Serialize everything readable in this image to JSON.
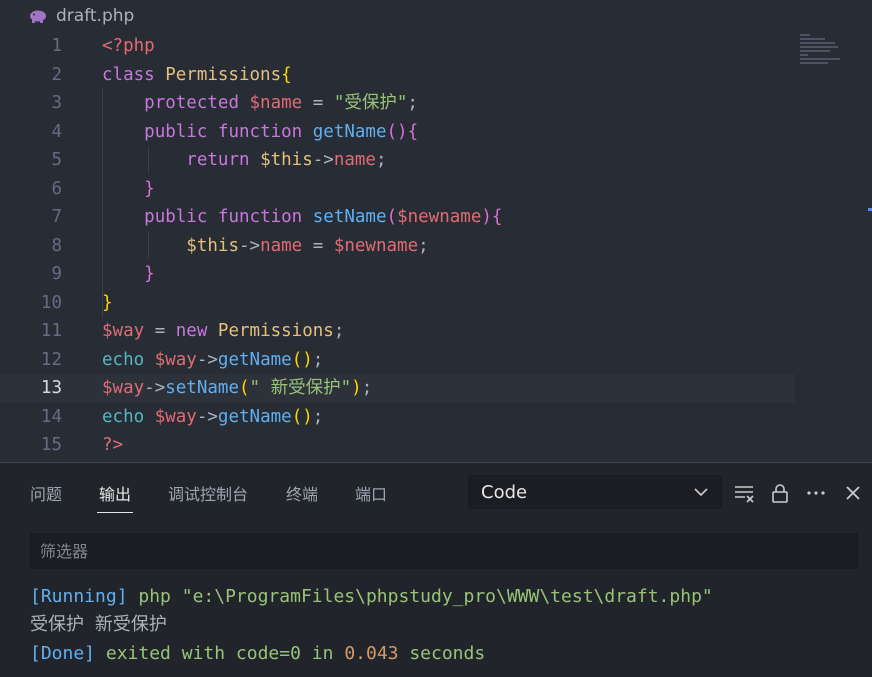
{
  "tab": {
    "filename": "draft.php"
  },
  "editor": {
    "active_line": 13,
    "lines": [
      {
        "n": "1",
        "tokens": [
          [
            "c-tag",
            "<?php"
          ]
        ]
      },
      {
        "n": "2",
        "tokens": [
          [
            "c-kw",
            "class "
          ],
          [
            "c-cls",
            "Permissions"
          ],
          [
            "c-br3",
            "{"
          ]
        ]
      },
      {
        "n": "3",
        "tokens": [
          [
            "c-plain",
            "    "
          ],
          [
            "c-kw",
            "protected "
          ],
          [
            "c-var",
            "$name"
          ],
          [
            "c-plain",
            " = "
          ],
          [
            "c-str",
            "\"受保护\""
          ],
          [
            "c-plain",
            ";"
          ]
        ]
      },
      {
        "n": "4",
        "tokens": [
          [
            "c-plain",
            "    "
          ],
          [
            "c-kw",
            "public "
          ],
          [
            "c-kw",
            "function "
          ],
          [
            "c-fn",
            "getName"
          ],
          [
            "c-br2",
            "(){"
          ]
        ]
      },
      {
        "n": "5",
        "tokens": [
          [
            "c-plain",
            "        "
          ],
          [
            "c-kw",
            "return "
          ],
          [
            "c-cls",
            "$this"
          ],
          [
            "c-plain",
            "->"
          ],
          [
            "c-var",
            "name"
          ],
          [
            "c-plain",
            ";"
          ]
        ]
      },
      {
        "n": "6",
        "tokens": [
          [
            "c-plain",
            "    "
          ],
          [
            "c-br2",
            "}"
          ]
        ]
      },
      {
        "n": "7",
        "tokens": [
          [
            "c-plain",
            "    "
          ],
          [
            "c-kw",
            "public "
          ],
          [
            "c-kw",
            "function "
          ],
          [
            "c-fn",
            "setName"
          ],
          [
            "c-br2",
            "("
          ],
          [
            "c-var",
            "$newname"
          ],
          [
            "c-br2",
            "){"
          ]
        ]
      },
      {
        "n": "8",
        "tokens": [
          [
            "c-plain",
            "        "
          ],
          [
            "c-cls",
            "$this"
          ],
          [
            "c-plain",
            "->"
          ],
          [
            "c-var",
            "name"
          ],
          [
            "c-plain",
            " = "
          ],
          [
            "c-var",
            "$newname"
          ],
          [
            "c-plain",
            ";"
          ]
        ]
      },
      {
        "n": "9",
        "tokens": [
          [
            "c-plain",
            "    "
          ],
          [
            "c-br2",
            "}"
          ]
        ]
      },
      {
        "n": "10",
        "tokens": [
          [
            "c-br3",
            "}"
          ]
        ]
      },
      {
        "n": "11",
        "tokens": [
          [
            "c-var",
            "$way"
          ],
          [
            "c-plain",
            " = "
          ],
          [
            "c-kw",
            "new "
          ],
          [
            "c-cls",
            "Permissions"
          ],
          [
            "c-plain",
            ";"
          ]
        ]
      },
      {
        "n": "12",
        "tokens": [
          [
            "c-echo",
            "echo "
          ],
          [
            "c-var",
            "$way"
          ],
          [
            "c-plain",
            "->"
          ],
          [
            "c-fn",
            "getName"
          ],
          [
            "c-br3",
            "()"
          ],
          [
            "c-plain",
            ";"
          ]
        ]
      },
      {
        "n": "13",
        "tokens": [
          [
            "c-var",
            "$way"
          ],
          [
            "c-plain",
            "->"
          ],
          [
            "c-fn",
            "setName"
          ],
          [
            "c-br3",
            "("
          ],
          [
            "c-str",
            "\" 新受保护\""
          ],
          [
            "c-br3",
            ")"
          ],
          [
            "c-plain",
            ";"
          ]
        ]
      },
      {
        "n": "14",
        "tokens": [
          [
            "c-echo",
            "echo "
          ],
          [
            "c-var",
            "$way"
          ],
          [
            "c-plain",
            "->"
          ],
          [
            "c-fn",
            "getName"
          ],
          [
            "c-br3",
            "()"
          ],
          [
            "c-plain",
            ";"
          ]
        ]
      },
      {
        "n": "15",
        "tokens": [
          [
            "c-tag",
            "?>"
          ]
        ]
      }
    ]
  },
  "panel": {
    "tabs": [
      {
        "label": "问题",
        "active": false
      },
      {
        "label": "输出",
        "active": true
      },
      {
        "label": "调试控制台",
        "active": false
      },
      {
        "label": "终端",
        "active": false
      },
      {
        "label": "端口",
        "active": false
      }
    ],
    "channel": "Code",
    "filter_placeholder": "筛选器",
    "output": {
      "running_tag": "[Running]",
      "running_cmd": " php \"e:\\ProgramFiles\\phpstudy_pro\\WWW\\test\\draft.php\"",
      "result_line": "受保护 新受保护",
      "done_tag": "[Done]",
      "done_text_1": " exited with ",
      "done_code": "code=0",
      "done_text_2": " in ",
      "done_time": "0.043",
      "done_text_3": " seconds"
    }
  },
  "colors": {
    "background": "#282c34",
    "panel": "#21252b",
    "accent": "#528bff"
  },
  "icons": [
    "php-elephant-icon",
    "chevron-down-icon",
    "clear-output-icon",
    "lock-icon",
    "more-icon",
    "close-icon"
  ]
}
